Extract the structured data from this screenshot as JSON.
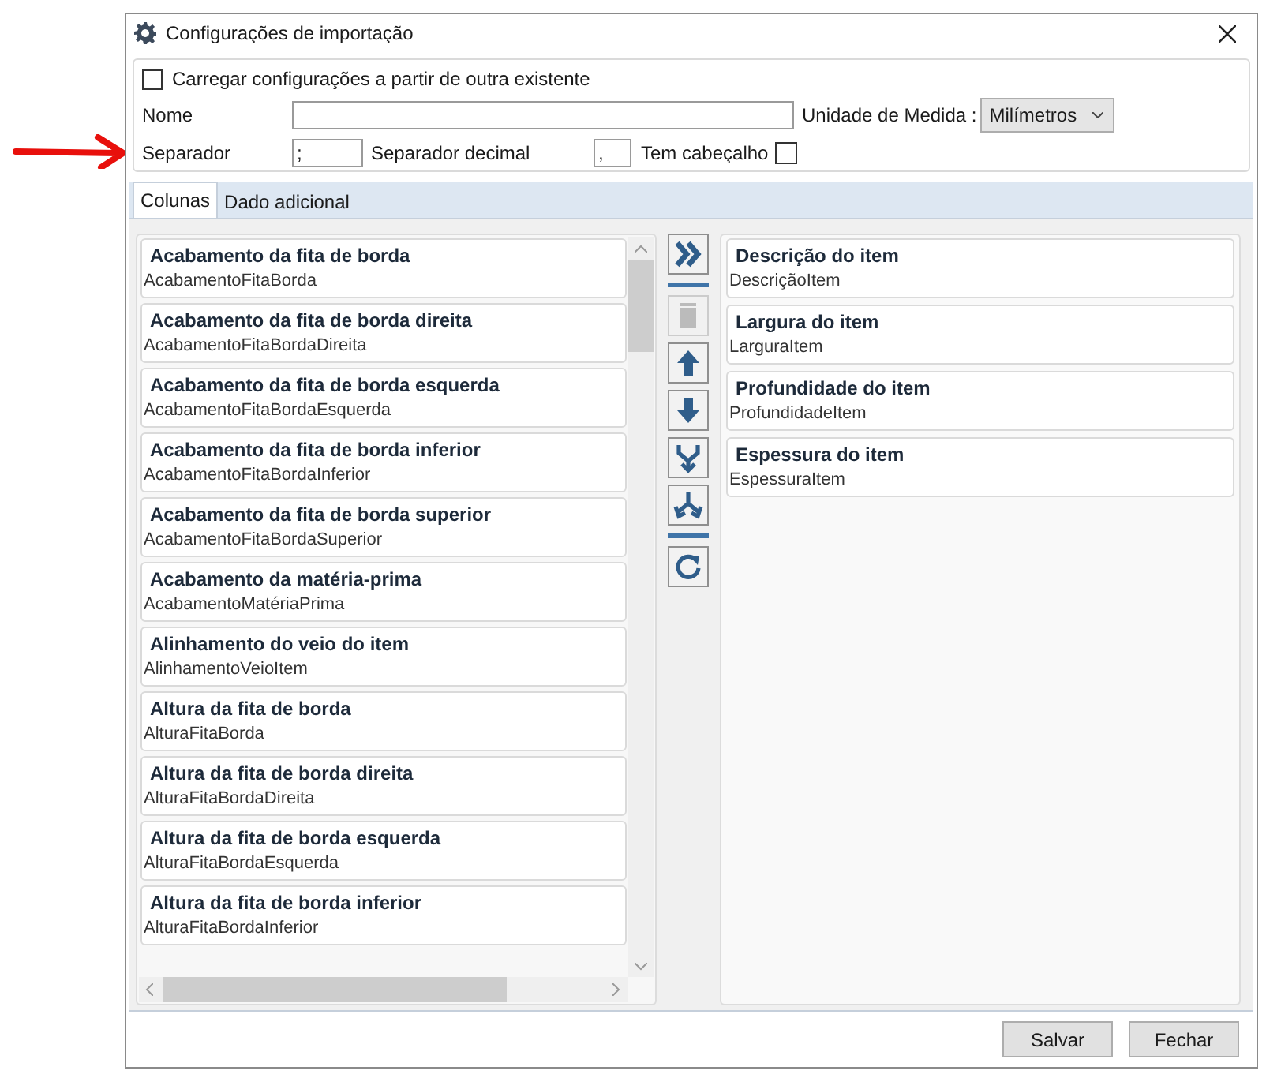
{
  "window": {
    "title": "Configurações de importação"
  },
  "load_existing": {
    "label": "Carregar configurações a partir de outra existente",
    "checked": false
  },
  "name": {
    "label": "Nome"
  },
  "unit": {
    "label": "Unidade de Medida :",
    "value": "Milímetros"
  },
  "separator": {
    "label": "Separador",
    "value": ";"
  },
  "decimal_separator": {
    "label": "Separador decimal",
    "value": ","
  },
  "has_header": {
    "label": "Tem cabeçalho",
    "checked": false
  },
  "tabs": [
    {
      "label": "Colunas",
      "selected": true
    },
    {
      "label": "Dado adicional",
      "selected": false
    }
  ],
  "available_columns": [
    {
      "title": "Acabamento da fita de borda",
      "field": "AcabamentoFitaBorda"
    },
    {
      "title": "Acabamento da fita de borda direita",
      "field": "AcabamentoFitaBordaDireita"
    },
    {
      "title": "Acabamento da fita de borda esquerda",
      "field": "AcabamentoFitaBordaEsquerda"
    },
    {
      "title": "Acabamento da fita de borda inferior",
      "field": "AcabamentoFitaBordaInferior"
    },
    {
      "title": "Acabamento da fita de borda superior",
      "field": "AcabamentoFitaBordaSuperior"
    },
    {
      "title": "Acabamento da matéria-prima",
      "field": "AcabamentoMatériaPrima"
    },
    {
      "title": "Alinhamento do veio do item",
      "field": "AlinhamentoVeioItem"
    },
    {
      "title": "Altura da fita de borda",
      "field": "AlturaFitaBorda"
    },
    {
      "title": "Altura da fita de borda direita",
      "field": "AlturaFitaBordaDireita"
    },
    {
      "title": "Altura da fita de borda esquerda",
      "field": "AlturaFitaBordaEsquerda"
    },
    {
      "title": "Altura da fita de borda inferior",
      "field": "AlturaFitaBordaInferior"
    }
  ],
  "toolbar": [
    {
      "kind": "add_all",
      "disabled": false
    },
    {
      "kind": "delete",
      "disabled": true
    },
    {
      "kind": "up",
      "disabled": false
    },
    {
      "kind": "down",
      "disabled": false
    },
    {
      "kind": "merge",
      "disabled": false
    },
    {
      "kind": "split",
      "disabled": false
    },
    {
      "kind": "reset",
      "disabled": false
    }
  ],
  "selected_columns": [
    {
      "title": "Descrição do item",
      "field": "DescriçãoItem"
    },
    {
      "title": "Largura do item",
      "field": "LarguraItem"
    },
    {
      "title": "Profundidade do item",
      "field": "ProfundidadeItem"
    },
    {
      "title": "Espessura do item",
      "field": "EspessuraItem"
    }
  ],
  "buttons": [
    "Salvar",
    "Fechar"
  ]
}
